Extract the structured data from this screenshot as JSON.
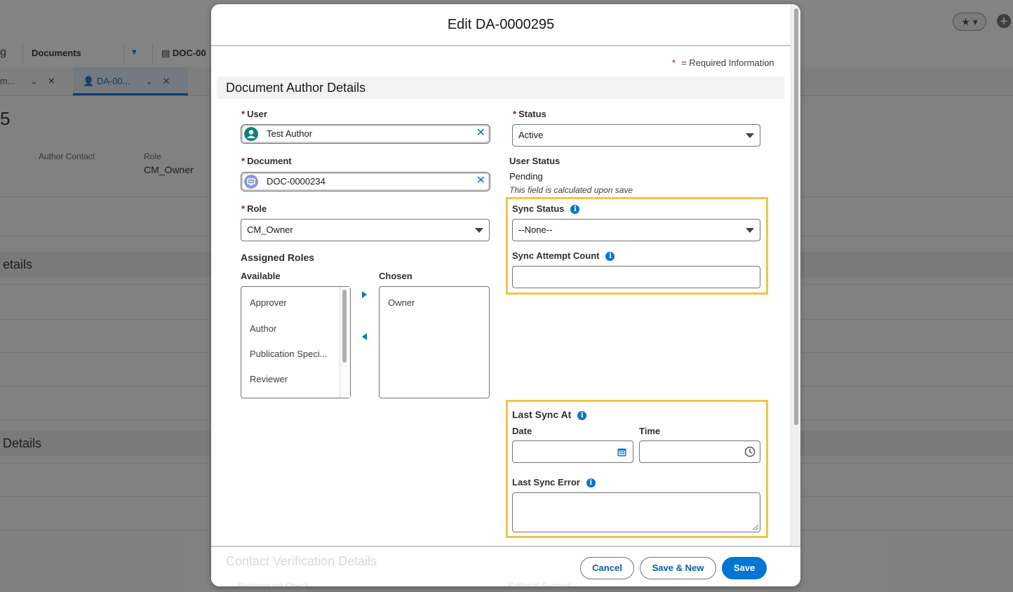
{
  "background": {
    "nav_partial": "g",
    "nav_documents": "Documents",
    "nav_doc_tab": "DOC-00",
    "tab1_label": "m...",
    "tab2_label": "DA-00...",
    "record_partial": "5",
    "field1_label": "Author Contact",
    "field2_label": "Role",
    "field2_value": "CM_Owner",
    "section1_partial": "etails",
    "section2_partial": "Details"
  },
  "modal": {
    "title": "Edit DA-0000295",
    "required_legend": "= Required Information",
    "required_star": "*",
    "section_title": "Document Author Details"
  },
  "form": {
    "user": {
      "label": "User",
      "value": "Test Author"
    },
    "document": {
      "label": "Document",
      "value": "DOC-0000234"
    },
    "role": {
      "label": "Role",
      "value": "CM_Owner"
    },
    "assigned_roles": {
      "label": "Assigned Roles",
      "available_label": "Available",
      "chosen_label": "Chosen",
      "available": [
        "Approver",
        "Author",
        "Publication Speci...",
        "Reviewer"
      ],
      "chosen": [
        "Owner"
      ]
    },
    "status": {
      "label": "Status",
      "value": "Active"
    },
    "user_status": {
      "label": "User Status",
      "value": "Pending",
      "note": "This field is calculated upon save"
    },
    "sync_status": {
      "label": "Sync Status",
      "value": "--None--"
    },
    "sync_attempt_count": {
      "label": "Sync Attempt Count",
      "value": ""
    },
    "last_sync_at": {
      "label": "Last Sync At",
      "date_label": "Date",
      "time_label": "Time",
      "date_value": "",
      "time_value": ""
    },
    "last_sync_error": {
      "label": "Last Sync Error",
      "value": ""
    }
  },
  "footer": {
    "next_section": "Contact Verification Details",
    "next_field1": "Background Check",
    "next_field2": "Editorial Support",
    "cancel_label": "Cancel",
    "save_new_label": "Save & New",
    "save_label": "Save"
  },
  "colors": {
    "brand": "#0176d3",
    "required": "#ba0517",
    "highlight": "#f4c542"
  },
  "icons": {
    "user": "user-avatar-icon",
    "document": "document-icon",
    "info": "info-icon",
    "calendar": "calendar-icon",
    "clock": "clock-icon"
  }
}
